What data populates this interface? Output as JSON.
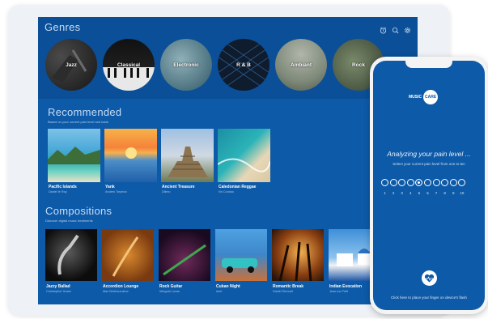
{
  "genres": {
    "title": "Genres",
    "items": [
      {
        "label": "Jazz"
      },
      {
        "label": "Classical"
      },
      {
        "label": "Electronic"
      },
      {
        "label": "R & B"
      },
      {
        "label": "Ambiant"
      },
      {
        "label": "Rock"
      }
    ],
    "icons": [
      "alarm-icon",
      "search-icon",
      "gear-icon"
    ]
  },
  "recommended": {
    "title": "Recommended",
    "subtitle": "Based on your current pain level and taste",
    "items": [
      {
        "title": "Pacific Islands",
        "sub": "Daniel le Roy"
      },
      {
        "title": "Yank",
        "sub": "Anders Torpedo"
      },
      {
        "title": "Ancient Treasure",
        "sub": "Dilimo"
      },
      {
        "title": "Caledonian Reggae",
        "sub": "Nn Cundou"
      }
    ]
  },
  "compositions": {
    "title": "Compositions",
    "subtitle": "Discover digital music treatments",
    "items": [
      {
        "title": "Jazzy Ballad",
        "sub": "Christopher Hoare"
      },
      {
        "title": "Accordion Lounge",
        "sub": "Max Berthoumieux"
      },
      {
        "title": "Rock Guitar",
        "sub": "Wingold Lucas"
      },
      {
        "title": "Cuban Night",
        "sub": "Axel"
      },
      {
        "title": "Romantic Break",
        "sub": "Daniel Renoult"
      },
      {
        "title": "Indian Evocation",
        "sub": "Jean-luc Petit"
      }
    ]
  },
  "phone": {
    "logo_left": "MUSIC",
    "logo_right": "CARE",
    "heading": "Analyzing your pain level ...",
    "instruction": "Select your current pain level from one to ten",
    "scale": [
      "1",
      "2",
      "3",
      "4",
      "5",
      "6",
      "7",
      "8",
      "9",
      "10"
    ],
    "selected_level": 5,
    "footer": "Click here to place your finger on device's flash",
    "heart_icon": "heart-pulse-icon"
  }
}
